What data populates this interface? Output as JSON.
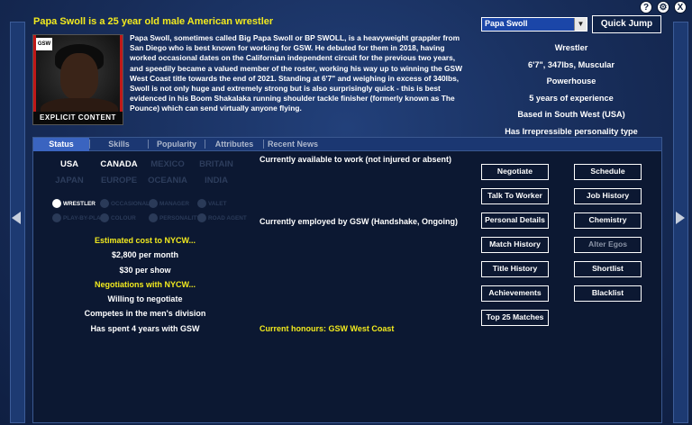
{
  "top_icons": [
    "?",
    "⚙",
    "X"
  ],
  "header": {
    "headline": "Papa Swoll is a 25 year old male American wrestler",
    "bio": "Papa Swoll, sometimes called Big Papa Swoll or BP SWOLL, is a heavyweight grappler from San Diego who is best known for working for GSW. He debuted for them in 2018, having worked occasional dates on the Californian independent circuit for the previous two years, and speedily became a valued member of the roster, working his way up to winning the GSW West Coast title towards the end of 2021. Standing at 6'7\" and weighing in excess of 340lbs, Swoll is not only huge and extremely strong but is also surprisingly quick - this is best evidenced in his Boom Shakalaka running shoulder tackle finisher (formerly known as The Pounce) which can send virtually anyone flying.",
    "photo_caption": "EXPLICIT CONTENT",
    "photo_logo": "GSW"
  },
  "quick_jump": {
    "selected": "Papa Swoll",
    "button": "Quick Jump"
  },
  "side_info": [
    "Wrestler",
    "6'7\", 347lbs, Muscular",
    "Powerhouse",
    "5 years of experience",
    "Based in South West (USA)",
    "Has Irrepressible personality type"
  ],
  "tabs": [
    "Status",
    "Skills",
    "Popularity",
    "Attributes",
    "Recent News"
  ],
  "active_tab": "Status",
  "nations": [
    {
      "label": "USA",
      "on": true
    },
    {
      "label": "CANADA",
      "on": true
    },
    {
      "label": "MEXICO",
      "on": false
    },
    {
      "label": "BRITAIN",
      "on": false
    },
    {
      "label": "JAPAN",
      "on": false
    },
    {
      "label": "EUROPE",
      "on": false
    },
    {
      "label": "OCEANIA",
      "on": false
    },
    {
      "label": "INDIA",
      "on": false
    }
  ],
  "badges": [
    {
      "label": "WRESTLER",
      "on": true
    },
    {
      "label": "OCCASIONAL",
      "on": false
    },
    {
      "label": "MANAGER",
      "on": false
    },
    {
      "label": "VALET",
      "on": false
    },
    {
      "label": "PLAY-BY-PLAY",
      "on": false
    },
    {
      "label": "COLOUR",
      "on": false
    },
    {
      "label": "PERSONALITY",
      "on": false
    },
    {
      "label": "ROAD AGENT",
      "on": false
    }
  ],
  "status": {
    "cost_header": "Estimated cost to NYCW...",
    "per_month": "$2,800 per month",
    "per_show": "$30 per show",
    "negotiations_header": "Negotiations with NYCW...",
    "willing": "Willing to negotiate",
    "division": "Competes in the men's division",
    "tenure": "Has spent 4 years with GSW",
    "availability": "Currently available to work (not injured or absent)",
    "employment": "Currently employed by GSW (Handshake, Ongoing)",
    "honours": "Current honours: GSW West Coast"
  },
  "buttons_left": [
    "Negotiate",
    "Talk To Worker",
    "Personal Details",
    "Match History",
    "Title History",
    "Achievements",
    "Top 25 Matches"
  ],
  "buttons_right": [
    "Schedule",
    "Job History",
    "Chemistry",
    "Alter Egos",
    "Shortlist",
    "Blacklist"
  ],
  "disabled_buttons": [
    "Alter Egos"
  ],
  "colors": {
    "accent_yellow": "#f2ea1e",
    "background": "#172c58",
    "panel": "#0c1832",
    "tab_active": "#3a64c0"
  }
}
